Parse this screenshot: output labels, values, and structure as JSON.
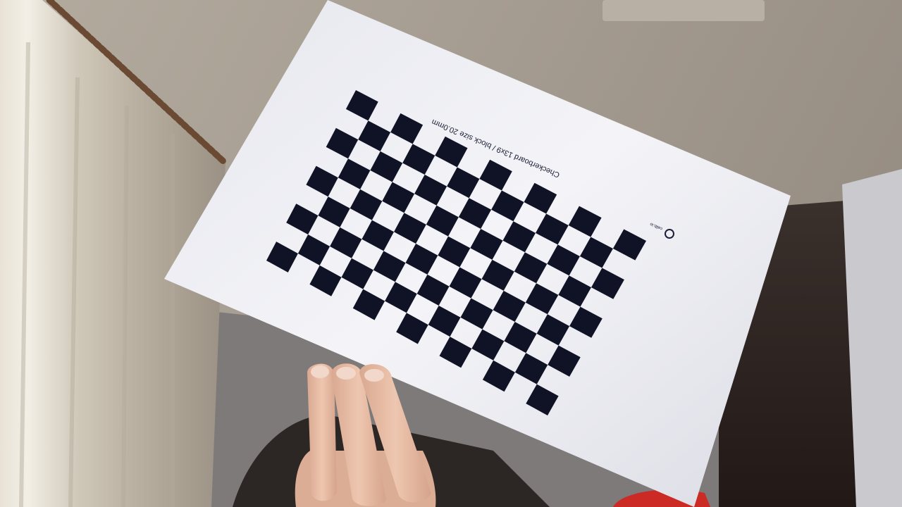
{
  "photo": {
    "description_hidden": "",
    "sheet": {
      "caption": "Checkerboard 13x9 / block size 20.0mm",
      "logo_text": "calib.io",
      "board": {
        "columns": 13,
        "rows": 9,
        "block_size_label": "20.0mm"
      },
      "ink_color": "#0f1325",
      "paper_color": "#f1f1f4"
    },
    "colors": {
      "wall": "#a29a8f",
      "curtain": "#d9d2c4",
      "doorway": "#2a1f1c",
      "cabinet": "#cfcfd3",
      "skin": "#e6bca5",
      "red_object": "#d22b25"
    }
  }
}
